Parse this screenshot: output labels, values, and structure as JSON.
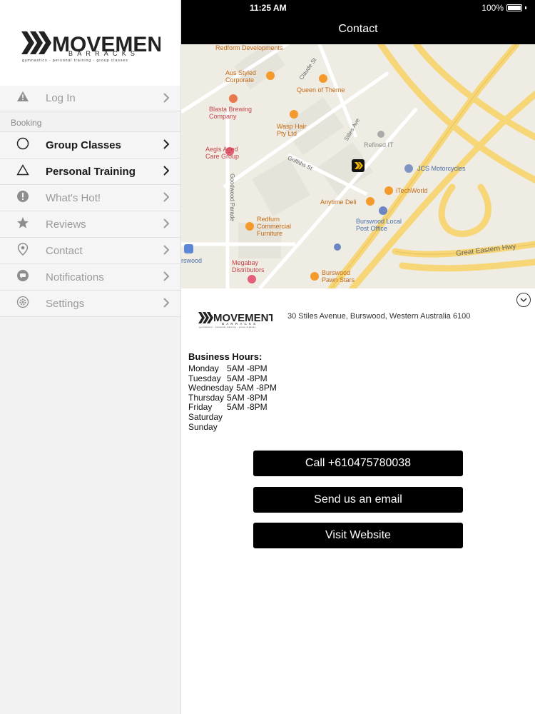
{
  "status": {
    "time": "11:25 AM",
    "battery": "100%"
  },
  "header": {
    "title": "Contact"
  },
  "brand": {
    "word_main": "MOVEMENT",
    "word_sub": "BARRACKS",
    "tagline": "gymnastics - personal training - group classes"
  },
  "sidebar": {
    "login": {
      "label": "Log In"
    },
    "section": "Booking",
    "items": [
      {
        "label": "Group Classes",
        "icon": "circle-icon",
        "active": true
      },
      {
        "label": "Personal Training",
        "icon": "triangle-icon",
        "active": true
      },
      {
        "label": "What's Hot!",
        "icon": "exclamation-icon",
        "active": false
      },
      {
        "label": "Reviews",
        "icon": "star-icon",
        "active": false
      },
      {
        "label": "Contact",
        "icon": "location-pin-icon",
        "active": false
      },
      {
        "label": "Notifications",
        "icon": "chat-icon",
        "active": false
      },
      {
        "label": "Settings",
        "icon": "gear-icon",
        "active": false
      }
    ]
  },
  "map": {
    "pois": [
      {
        "name": "Redform Developments"
      },
      {
        "name": "Aus Styled Corporate"
      },
      {
        "name": "Queen of Theme"
      },
      {
        "name": "Blasta Brewing Company"
      },
      {
        "name": "Wasp Hair Pty Ltd"
      },
      {
        "name": "Refined IT"
      },
      {
        "name": "Aegis Aged Care Group"
      },
      {
        "name": "JCS Motorcycles"
      },
      {
        "name": "iTechWorld"
      },
      {
        "name": "Anytime Deli"
      },
      {
        "name": "Burswood Local Post Office"
      },
      {
        "name": "Redfurn Commercial Furniture"
      },
      {
        "name": "Megabay Distributors"
      },
      {
        "name": "Burswood Pawn Stars"
      },
      {
        "name": "rswood"
      }
    ],
    "roads": [
      "Claude St",
      "Stiles Ave",
      "Griffiths St",
      "Goodwood Parade",
      "Great Eastern Hwy"
    ]
  },
  "contact": {
    "address": "30 Stiles Avenue, Burswood, Western Australia 6100",
    "hours_title": "Business Hours:",
    "hours": [
      {
        "day": "Monday",
        "time": "5AM -8PM"
      },
      {
        "day": "Tuesday",
        "time": "5AM -8PM"
      },
      {
        "day": "Wednesday",
        "time": "5AM -8PM"
      },
      {
        "day": "Thursday",
        "time": "5AM -8PM"
      },
      {
        "day": "Friday",
        "time": "5AM -8PM"
      },
      {
        "day": "Saturday",
        "time": ""
      },
      {
        "day": "Sunday",
        "time": ""
      }
    ],
    "call_label": "Call +610475780038",
    "email_label": "Send us an email",
    "website_label": "Visit Website"
  }
}
